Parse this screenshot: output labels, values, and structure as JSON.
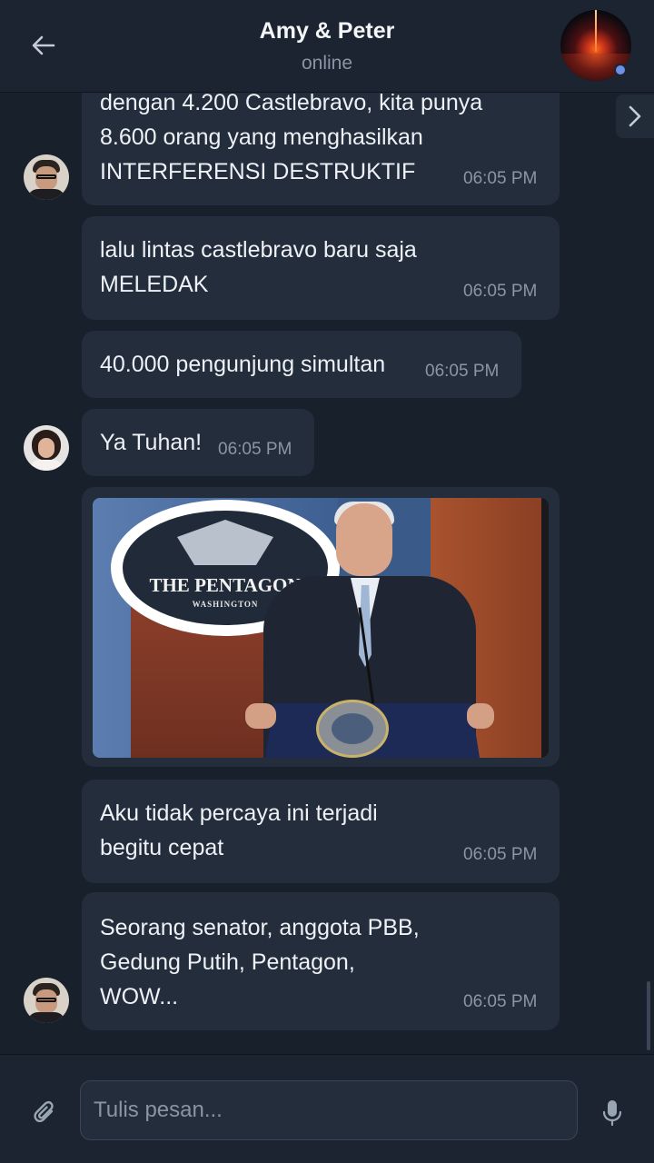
{
  "header": {
    "title": "Amy & Peter",
    "status": "online",
    "avatar_icon": "group-avatar-explosion",
    "back_icon": "arrow-left-icon",
    "side_icon": "chevron-right-icon"
  },
  "messages": [
    {
      "sender": "peter",
      "text": "dengan 4.200 Castlebravo, kita punya\n8.600 orang yang menghasilkan\nINTERFERENSI DESTRUKTIF",
      "time": "06:05 PM"
    },
    {
      "sender": "peter",
      "text": "lalu lintas castlebravo baru saja\nMELEDAK",
      "time": "06:05 PM"
    },
    {
      "sender": "peter",
      "text": "40.000 pengunjung simultan",
      "time": "06:05 PM"
    },
    {
      "sender": "amy",
      "text": "Ya Tuhan!",
      "time": "06:05 PM"
    },
    {
      "sender": "peter",
      "type": "image",
      "image": {
        "seal_title": "THE PENTAGON",
        "seal_subtitle": "WASHINGTON"
      }
    },
    {
      "sender": "peter",
      "text": "Aku tidak percaya ini terjadi\nbegitu cepat",
      "time": "06:05 PM"
    },
    {
      "sender": "peter",
      "text": "Seorang senator, anggota PBB,\nGedung Putih, Pentagon,\nWOW...",
      "time": "06:05 PM"
    }
  ],
  "composer": {
    "placeholder": "Tulis pesan...",
    "attach_icon": "paperclip-icon",
    "mic_icon": "microphone-icon"
  },
  "colors": {
    "background": "#18202b",
    "bubble": "#232d3b",
    "header": "#1b2430",
    "time_text": "#8b96a5",
    "online_dot": "#6f8fe8"
  }
}
